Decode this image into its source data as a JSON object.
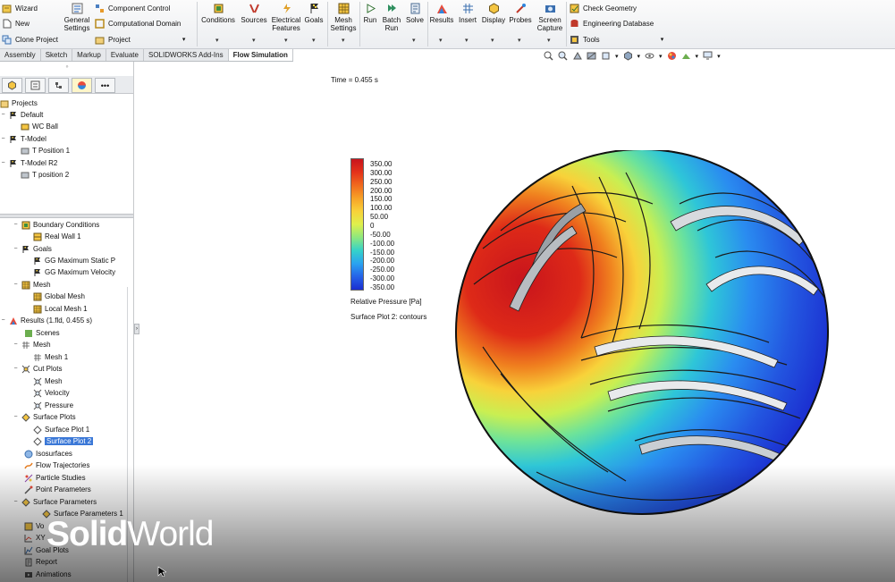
{
  "ribbon": {
    "left_col": [
      "Wizard",
      "New",
      "Clone Project"
    ],
    "mid_col": [
      "Component Control",
      "Computational Domain",
      "Project"
    ],
    "general_settings": "General Settings",
    "buttons": [
      "Conditions",
      "Sources",
      "Electrical Features",
      "Goals",
      "Mesh Settings",
      "Run",
      "Batch Run",
      "Solve",
      "Results",
      "Insert",
      "Display",
      "Probes",
      "Screen Capture"
    ],
    "right_col": [
      "Check Geometry",
      "Engineering Database",
      "Tools"
    ]
  },
  "tabs": [
    {
      "label": "Assembly",
      "active": false
    },
    {
      "label": "Sketch",
      "active": false
    },
    {
      "label": "Markup",
      "active": false
    },
    {
      "label": "Evaluate",
      "active": false
    },
    {
      "label": "SOLIDWORKS Add-Ins",
      "active": false
    },
    {
      "label": "Flow Simulation",
      "active": true
    }
  ],
  "view_toolbar": {
    "icons": [
      "zoom-fit-icon",
      "zoom-area-icon",
      "previous-view-icon",
      "section-view-icon",
      "view-orientation-icon",
      "display-style-icon",
      "hide-show-icon",
      "appearance-icon",
      "scene-icon",
      "monitor-icon"
    ]
  },
  "panel": {
    "tabs": [
      "feature-manager-icon",
      "property-manager-icon",
      "configuration-manager-icon",
      "flow-analysis-icon",
      "more-icon"
    ],
    "more_label": "•••",
    "projects": {
      "title": "Projects",
      "items": [
        {
          "label": "Default",
          "child": "WC Ball"
        },
        {
          "label": "T-Model",
          "child": "T Position 1"
        },
        {
          "label": "T-Model R2",
          "child": "T position 2"
        }
      ]
    },
    "tree": {
      "boundary_conditions": "Boundary Conditions",
      "real_wall": "Real Wall 1",
      "goals": "Goals",
      "goal_static": "GG Maximum Static P",
      "goal_velocity": "GG Maximum Velocity",
      "mesh": "Mesh",
      "global_mesh": "Global Mesh",
      "local_mesh": "Local Mesh 1",
      "results": "Results (1.fld, 0.455 s)",
      "scenes": "Scenes",
      "results_mesh": "Mesh",
      "mesh_1": "Mesh 1",
      "cut_plots": "Cut Plots",
      "cut_mesh": "Mesh",
      "cut_velocity": "Velocity",
      "cut_pressure": "Pressure",
      "surface_plots": "Surface Plots",
      "surface_plot_1": "Surface Plot 1",
      "surface_plot_2": "Surface Plot 2",
      "isosurfaces": "Isosurfaces",
      "flow_trajectories": "Flow Trajectories",
      "particle_studies": "Particle Studies",
      "point_parameters": "Point Parameters",
      "surface_parameters": "Surface Parameters",
      "surface_parameters_1": "Surface Parameters 1",
      "volume_parameters": "Vo",
      "xy_plots": "XY",
      "goal_plots": "Goal Plots",
      "report": "Report",
      "animations": "Animations"
    }
  },
  "viewport": {
    "time": "Time = 0.455 s",
    "legend_ticks": [
      "350.00",
      "300.00",
      "250.00",
      "200.00",
      "150.00",
      "100.00",
      "50.00",
      "0",
      "-50.00",
      "-100.00",
      "-150.00",
      "-200.00",
      "-250.00",
      "-300.00",
      "-350.00"
    ],
    "legend_title": "Relative Pressure [Pa]",
    "plot_name": "Surface Plot 2: contours",
    "colors": {
      "high": "#c8141c",
      "mid": "#dff04c",
      "low": "#1b2ed0"
    }
  },
  "watermark": {
    "bold": "Solid",
    "regular": "World"
  }
}
